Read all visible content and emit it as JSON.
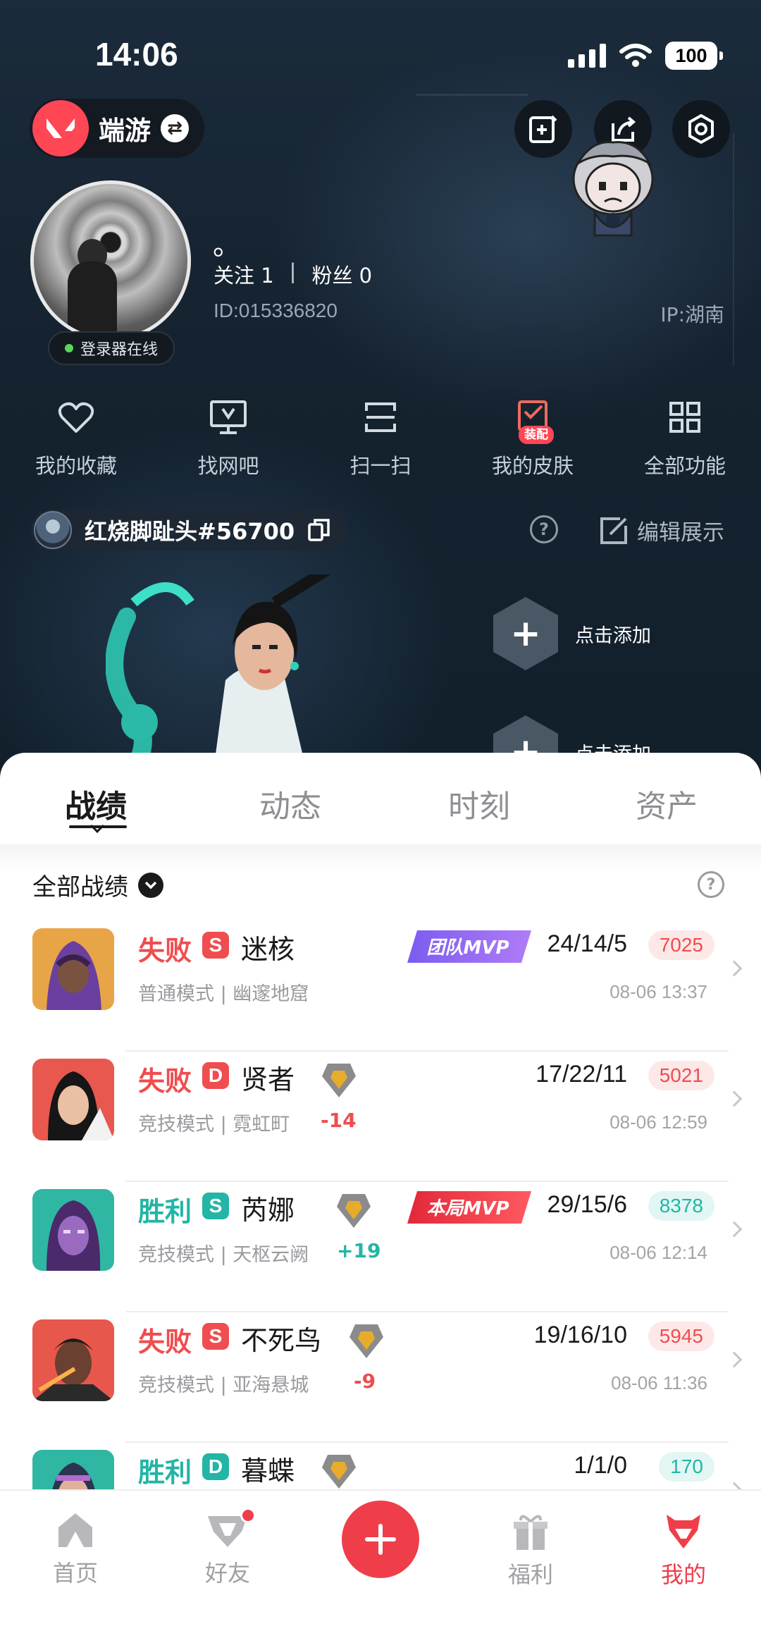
{
  "status_bar": {
    "time": "14:06",
    "battery": "100"
  },
  "header": {
    "app_name": "端游"
  },
  "profile": {
    "nickname": "。",
    "following_label": "关注 1",
    "followers_label": "粉丝 0",
    "separator": "|",
    "uid": "ID:015336820",
    "ip": "IP:湖南",
    "online_status": "登录器在线"
  },
  "shortcuts": [
    {
      "label": "我的收藏",
      "icon": "heart-icon"
    },
    {
      "label": "找网吧",
      "icon": "monitor-icon"
    },
    {
      "label": "扫一扫",
      "icon": "scan-icon"
    },
    {
      "label": "我的皮肤",
      "icon": "skin-icon",
      "tag": "装配"
    },
    {
      "label": "全部功能",
      "icon": "grid-icon"
    }
  ],
  "game_account": {
    "name": "红烧脚趾头#56700",
    "edit_label": "编辑展示",
    "help": "?"
  },
  "showcase": {
    "add_label_1": "点击添加",
    "add_label_2": "点击添加",
    "plus": "+"
  },
  "tabs": [
    "战绩",
    "动态",
    "时刻",
    "资产"
  ],
  "filter": {
    "label": "全部战绩",
    "help": "?"
  },
  "matches": [
    {
      "result": "失败",
      "result_type": "lose",
      "rank_letter": "S",
      "agent": "迷核",
      "mode": "普通模式",
      "map": "幽邃地窟",
      "mvp": "团队MVP",
      "kda": "24/14/5",
      "score": "7025",
      "time": "08-06 13:37",
      "rank_delta": ""
    },
    {
      "result": "失败",
      "result_type": "lose",
      "rank_letter": "D",
      "agent": "贤者",
      "mode": "竞技模式",
      "map": "霓虹町",
      "mvp": "",
      "kda": "17/22/11",
      "score": "5021",
      "time": "08-06 12:59",
      "rank_delta": "-14"
    },
    {
      "result": "胜利",
      "result_type": "win",
      "rank_letter": "S",
      "agent": "芮娜",
      "mode": "竞技模式",
      "map": "天枢云阙",
      "mvp": "本局MVP",
      "kda": "29/15/6",
      "score": "8378",
      "time": "08-06 12:14",
      "rank_delta": "+19"
    },
    {
      "result": "失败",
      "result_type": "lose",
      "rank_letter": "S",
      "agent": "不死鸟",
      "mode": "竞技模式",
      "map": "亚海悬城",
      "mvp": "",
      "kda": "19/16/10",
      "score": "5945",
      "time": "08-06 11:36",
      "rank_delta": "-9"
    },
    {
      "result": "胜利",
      "result_type": "win",
      "rank_letter": "D",
      "agent": "暮蝶",
      "mode": "",
      "map": "",
      "mvp": "",
      "kda": "1/1/0",
      "score": "170",
      "time": "",
      "rank_delta": ""
    }
  ],
  "bottom_nav": [
    {
      "label": "首页",
      "icon": "home-icon"
    },
    {
      "label": "好友",
      "icon": "friends-icon"
    },
    {
      "label": "",
      "icon": "plus-icon"
    },
    {
      "label": "福利",
      "icon": "gift-icon"
    },
    {
      "label": "我的",
      "icon": "profile-icon",
      "active": true
    }
  ],
  "colors": {
    "accent": "#ef3e4a",
    "lose": "#ef4d4f",
    "win": "#23b5a5"
  }
}
